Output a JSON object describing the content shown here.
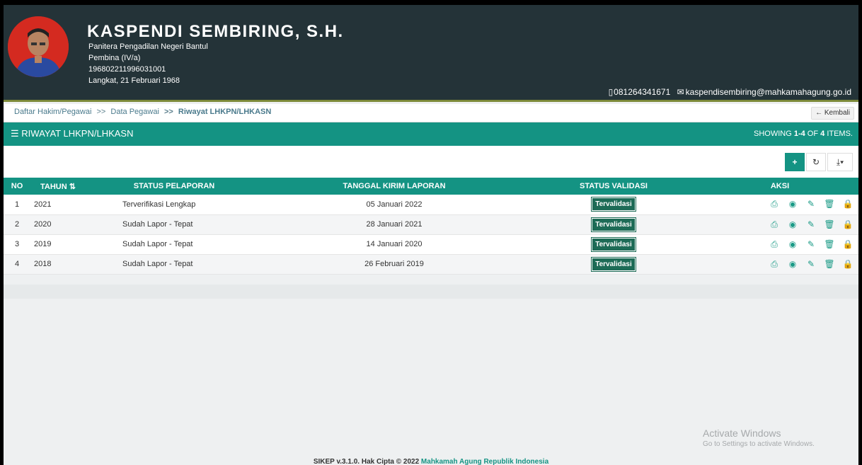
{
  "profile": {
    "name": "KASPENDI SEMBIRING, S.H.",
    "position": "Panitera Pengadilan Negeri Bantul",
    "rank": "Pembina (IV/a)",
    "nip": "196802211996031001",
    "birth": "Langkat, 21 Februari 1968",
    "phone": "081264341671",
    "email": "kaspendisembiring@mahkamahagung.go.id"
  },
  "breadcrumb": {
    "item1": "Daftar Hakim/Pegawai",
    "item2": "Data Pegawai",
    "current": "Riwayat LHKPN/LHKASN",
    "sep": ">>",
    "back_label": "Kembali"
  },
  "panel": {
    "title": "RIWAYAT LHKPN/LHKASN",
    "showing_prefix": "SHOWING ",
    "showing_range": "1-4",
    "showing_of": " OF ",
    "showing_total": "4",
    "showing_suffix": " ITEMS."
  },
  "toolbar": {
    "add": "+",
    "refresh": "↻",
    "export": "⤓▾"
  },
  "table": {
    "headers": {
      "no": "NO",
      "tahun": "TAHUN",
      "status": "STATUS PELAPORAN",
      "tanggal": "TANGGAL KIRIM LAPORAN",
      "validasi": "STATUS VALIDASI",
      "aksi": "AKSI"
    },
    "rows": [
      {
        "no": "1",
        "tahun": "2021",
        "status": "Terverifikasi Lengkap",
        "tanggal": "05 Januari 2022",
        "validasi": "Tervalidasi"
      },
      {
        "no": "2",
        "tahun": "2020",
        "status": "Sudah Lapor - Tepat",
        "tanggal": "28 Januari 2021",
        "validasi": "Tervalidasi"
      },
      {
        "no": "3",
        "tahun": "2019",
        "status": "Sudah Lapor - Tepat",
        "tanggal": "14 Januari 2020",
        "validasi": "Tervalidasi"
      },
      {
        "no": "4",
        "tahun": "2018",
        "status": "Sudah Lapor - Tepat",
        "tanggal": "26 Februari 2019",
        "validasi": "Tervalidasi"
      }
    ]
  },
  "icons": {
    "pdf": "pdf-icon",
    "view": "eye-icon",
    "edit": "pencil-icon",
    "delete": "trash-icon",
    "lock": "lock-icon",
    "sort": "sort-icon",
    "list": "list-icon"
  },
  "watermark": {
    "line1": "Activate Windows",
    "line2": "Go to Settings to activate Windows."
  },
  "footer": {
    "text": "SIKEP v.3.1.0. Hak Cipta © 2022 ",
    "link": "Mahkamah Agung Republik Indonesia"
  },
  "colors": {
    "header": "#243338",
    "primary": "#149383",
    "badge": "#1d6b56"
  }
}
